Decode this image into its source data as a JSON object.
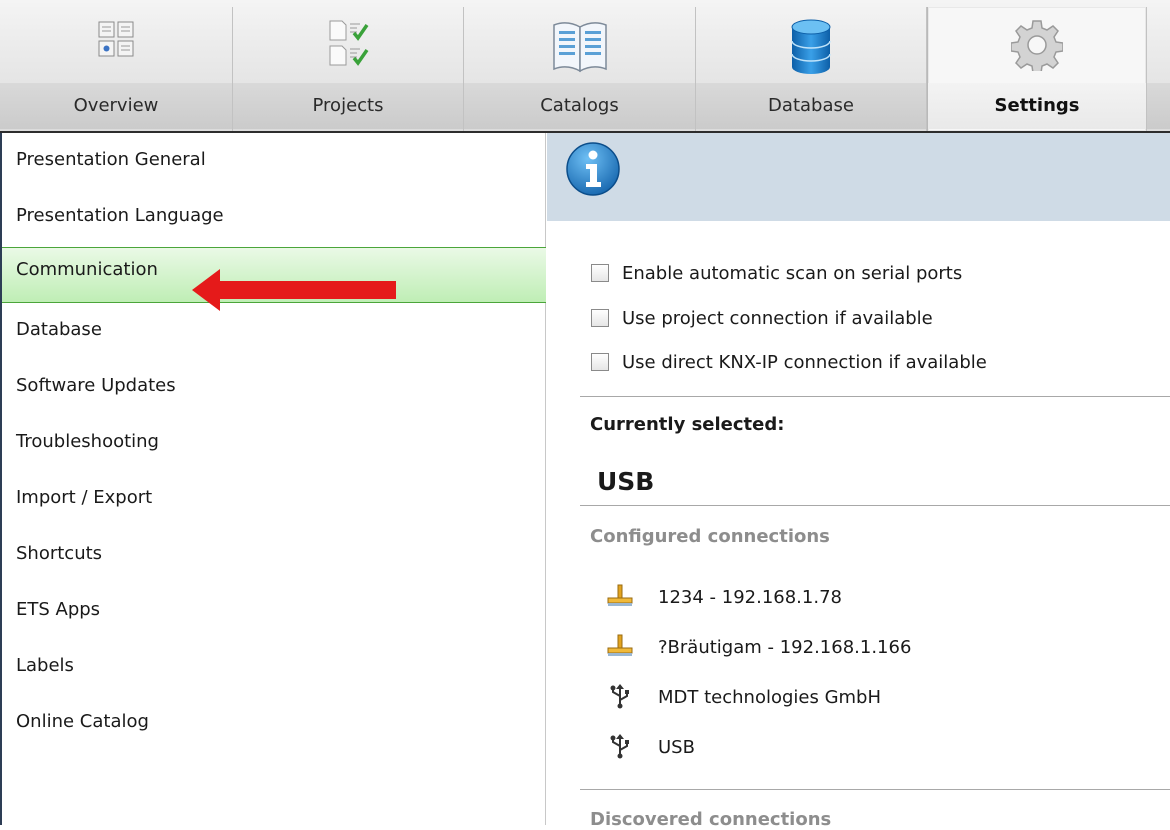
{
  "toolbar": {
    "tabs": [
      {
        "label": "Overview",
        "icon": "overview-icon"
      },
      {
        "label": "Projects",
        "icon": "projects-icon"
      },
      {
        "label": "Catalogs",
        "icon": "catalogs-icon"
      },
      {
        "label": "Database",
        "icon": "database-icon"
      },
      {
        "label": "Settings",
        "icon": "gear-icon",
        "active": true
      }
    ]
  },
  "sidebar": {
    "selected": "Communication",
    "items": [
      {
        "label": "Presentation General"
      },
      {
        "label": "Presentation Language"
      },
      {
        "label": "Communication"
      },
      {
        "label": "Database"
      },
      {
        "label": "Software Updates"
      },
      {
        "label": "Troubleshooting"
      },
      {
        "label": "Import / Export"
      },
      {
        "label": "Shortcuts"
      },
      {
        "label": "ETS Apps"
      },
      {
        "label": "Labels"
      },
      {
        "label": "Online Catalog"
      }
    ]
  },
  "content": {
    "options": [
      {
        "label": "Enable automatic scan on serial ports",
        "checked": false
      },
      {
        "label": "Use project connection if available",
        "checked": false
      },
      {
        "label": "Use direct KNX-IP connection if available",
        "checked": false
      }
    ],
    "currently_selected_label": "Currently selected:",
    "currently_selected_value": "USB",
    "configured_header": "Configured connections",
    "configured": [
      {
        "label": "1234 - 192.168.1.78",
        "icon": "network-icon"
      },
      {
        "label": "?Bräutigam - 192.168.1.166",
        "icon": "network-icon"
      },
      {
        "label": "MDT technologies GmbH",
        "icon": "usb-icon"
      },
      {
        "label": "USB",
        "icon": "usb-icon"
      }
    ],
    "discovered_header": "Discovered connections"
  },
  "colors": {
    "selected_bg": "#bfeeb5",
    "info_bar": "#cfdbe6",
    "arrow": "#e51a1a",
    "info_icon": "#1e7fc4"
  }
}
